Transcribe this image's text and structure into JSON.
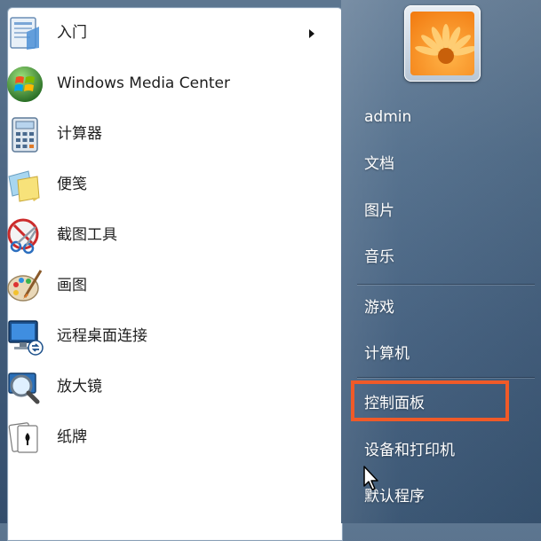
{
  "programs": [
    {
      "label": "入门",
      "icon": "getting-started-icon",
      "has_submenu": true
    },
    {
      "label": "Windows Media Center",
      "icon": "windows-media-center-icon",
      "has_submenu": false
    },
    {
      "label": "计算器",
      "icon": "calculator-icon",
      "has_submenu": false
    },
    {
      "label": "便笺",
      "icon": "sticky-notes-icon",
      "has_submenu": false
    },
    {
      "label": "截图工具",
      "icon": "snipping-tool-icon",
      "has_submenu": false
    },
    {
      "label": "画图",
      "icon": "paint-icon",
      "has_submenu": false
    },
    {
      "label": "远程桌面连接",
      "icon": "remote-desktop-icon",
      "has_submenu": false
    },
    {
      "label": "放大镜",
      "icon": "magnifier-icon",
      "has_submenu": false
    },
    {
      "label": "纸牌",
      "icon": "solitaire-icon",
      "has_submenu": false
    }
  ],
  "places": [
    {
      "label": "admin"
    },
    {
      "label": "文档"
    },
    {
      "label": "图片"
    },
    {
      "label": "音乐"
    },
    {
      "label": "游戏"
    },
    {
      "label": "计算机"
    },
    {
      "label": "控制面板",
      "highlighted": true
    },
    {
      "label": "设备和打印机"
    },
    {
      "label": "默认程序"
    }
  ],
  "colors": {
    "highlight_border": "#f05a28",
    "right_pane_text": "#ffffff",
    "left_pane_bg": "#ffffff"
  },
  "user_picture": "flower-avatar-icon"
}
